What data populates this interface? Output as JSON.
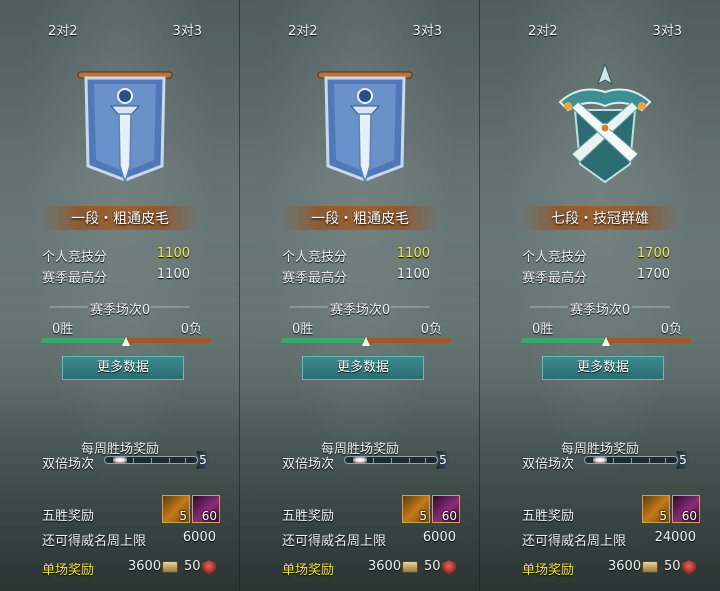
{
  "panels": [
    {
      "tabs": {
        "left": "2对2",
        "right": "3对3"
      },
      "emblem": "blue-banner-sword-emblem",
      "rank": "一段・粗通皮毛",
      "personal_score_label": "个人竞技分",
      "personal_score": "1100",
      "season_high_label": "赛季最高分",
      "season_high": "1100",
      "season_matches_label": "赛季场次0",
      "wins": "0胜",
      "losses": "0负",
      "win_ratio": 0.5,
      "more_button": "更多数据",
      "weekly_title": "每周胜场奖励",
      "double_label": "双倍场次",
      "double_count": "5",
      "five_win_label": "五胜奖励",
      "reward_a_count": "5",
      "reward_b_count": "60",
      "limit_label": "还可得威名周上限",
      "limit_value": "6000",
      "single_label": "单场奖励",
      "single_value_1": "3600",
      "single_value_2": "50"
    },
    {
      "tabs": {
        "left": "2对2",
        "right": "3对3"
      },
      "emblem": "blue-banner-sword-emblem",
      "rank": "一段・粗通皮毛",
      "personal_score_label": "个人竞技分",
      "personal_score": "1100",
      "season_high_label": "赛季最高分",
      "season_high": "1100",
      "season_matches_label": "赛季场次0",
      "wins": "0胜",
      "losses": "0负",
      "win_ratio": 0.5,
      "more_button": "更多数据",
      "weekly_title": "每周胜场奖励",
      "double_label": "双倍场次",
      "double_count": "5",
      "five_win_label": "五胜奖励",
      "reward_a_count": "5",
      "reward_b_count": "60",
      "limit_label": "还可得威名周上限",
      "limit_value": "6000",
      "single_label": "单场奖励",
      "single_value_1": "3600",
      "single_value_2": "50"
    },
    {
      "tabs": {
        "left": "2对2",
        "right": "3对3"
      },
      "emblem": "teal-crossed-swords-emblem",
      "rank": "七段・技冠群雄",
      "personal_score_label": "个人竞技分",
      "personal_score": "1700",
      "season_high_label": "赛季最高分",
      "season_high": "1700",
      "season_matches_label": "赛季场次0",
      "wins": "0胜",
      "losses": "0负",
      "win_ratio": 0.5,
      "more_button": "更多数据",
      "weekly_title": "每周胜场奖励",
      "double_label": "双倍场次",
      "double_count": "5",
      "five_win_label": "五胜奖励",
      "reward_a_count": "5",
      "reward_b_count": "60",
      "limit_label": "还可得威名周上限",
      "limit_value": "24000",
      "single_label": "单场奖励",
      "single_value_1": "3600",
      "single_value_2": "50"
    }
  ],
  "colors": {
    "highlight_score": "#ffe94a",
    "single_reward_label": "#f0e34a",
    "win_bar": "#3aa86b",
    "loss_bar": "#9a5a2c",
    "button": "#2a6e73"
  }
}
